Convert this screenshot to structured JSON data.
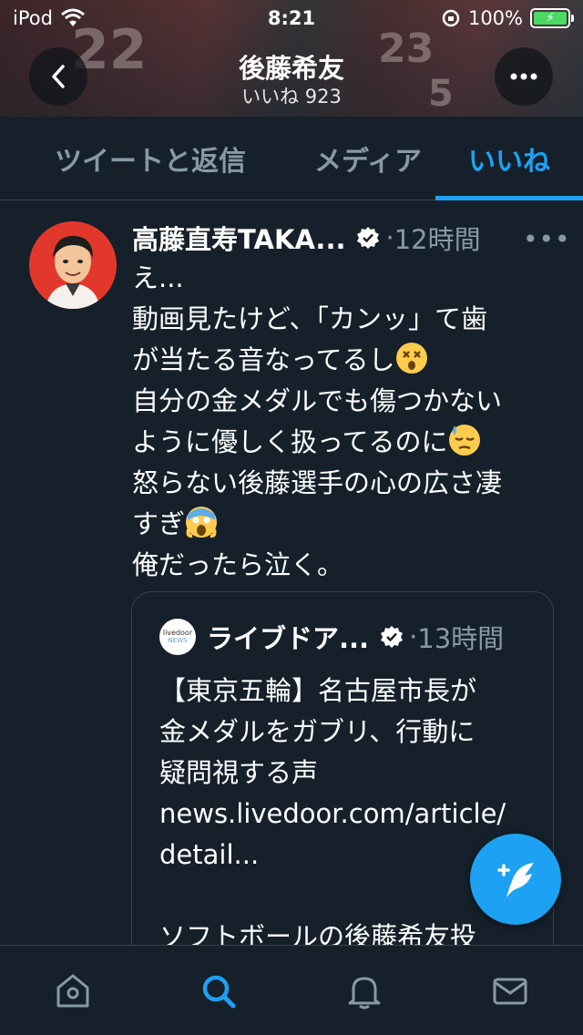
{
  "status": {
    "carrier": "iPod",
    "time": "8:21",
    "battery": "100%"
  },
  "header": {
    "title": "後藤希友",
    "subtitle": "いいね 923"
  },
  "tabs": [
    {
      "label": "ツイートと返信",
      "selected": false
    },
    {
      "label": "メディア",
      "selected": false
    },
    {
      "label": "いいね",
      "selected": true
    }
  ],
  "tweet": {
    "name": "高藤直寿TAKA...",
    "sep": "·",
    "time": "12時間",
    "lines": [
      "え...",
      "動画見たけど、「カンッ」て歯",
      "が当たる音なってるし",
      "自分の金メダルでも傷つかない",
      "ように優しく扱ってるのに",
      "怒らない後藤選手の心の広さ凄",
      "すぎ",
      "俺だったら泣く。"
    ],
    "emojis": [
      "dizzy-face",
      "downcast-sweat-face",
      "screaming-face"
    ]
  },
  "quote": {
    "logo_top": "livedoor",
    "logo_bottom": "NEWS",
    "name": "ライブドア...",
    "sep": "·",
    "time": "13時間",
    "body": "【東京五輪】名古屋市長が\n金メダルをガブリ、行動に\n疑問視する声\nnews.livedoor.com/article/\ndetail...\n\nソフトボールの後藤希友投"
  },
  "bottom_nav": [
    "home-icon",
    "search-icon",
    "notifications-icon",
    "messages-icon"
  ],
  "colors": {
    "background": "#15202b",
    "accent": "#1da1f2",
    "secondary_text": "#8899a6",
    "divider": "#38444d"
  }
}
